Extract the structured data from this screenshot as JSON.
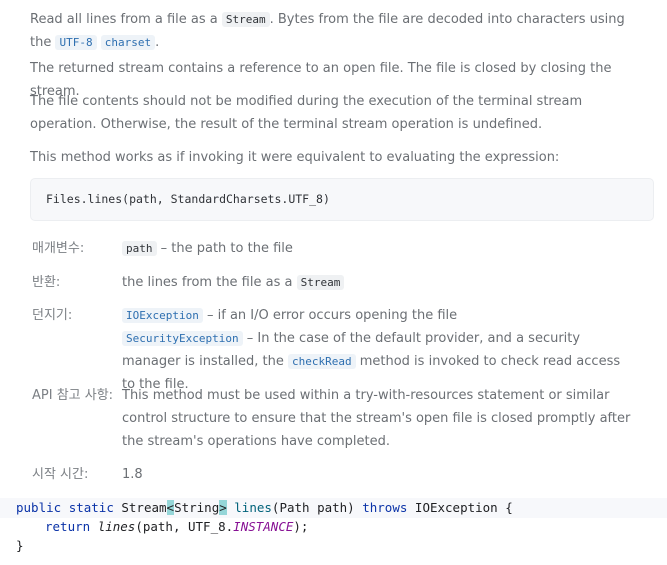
{
  "doc": {
    "p1": {
      "t1": "Read all lines from a file as a ",
      "c1": "Stream",
      "t2": ". Bytes from the file are decoded into characters using the ",
      "c2": "UTF-8",
      "t3": " ",
      "c3": "charset",
      "t4": "."
    },
    "p2": "The returned stream contains a reference to an open file. The file is closed by closing the stream.",
    "p3": "The file contents should not be modified during the execution of the terminal stream operation. Otherwise, the result of the terminal stream operation is undefined.",
    "p4": "This method works as if invoking it were equivalent to evaluating the expression:",
    "codeblock": "Files.lines(path, StandardCharsets.UTF_8)",
    "params": {
      "label": "매개변수:",
      "code": "path",
      "text": " – the path to the file"
    },
    "returns": {
      "label": "반환:",
      "text": "the lines from the file as a ",
      "code": "Stream"
    },
    "throws": {
      "label": "던지기:",
      "e1": "IOException",
      "e1_text": " – if an I/O error occurs opening the file",
      "e2": "SecurityException",
      "e2_text1": " – In the case of the default provider, and a security manager is installed, the ",
      "e2_code": "checkRead",
      "e2_text2": " method is invoked to check read access to the file."
    },
    "api_note": {
      "label": "API 참고 사항:",
      "text": "This method must be used within a try-with-resources statement or similar control structure to ensure that the stream's open file is closed promptly after the stream's operations have completed."
    },
    "since": {
      "label": "시작 시간:",
      "value": "1.8"
    }
  },
  "code": {
    "line1": {
      "kw1": "public",
      "kw2": "static",
      "type": "Stream",
      "lt": "<",
      "generic": "String",
      "gt": ">",
      "method": "lines",
      "params": "(Path path) ",
      "kw3": "throws",
      "exc": " IOException {"
    },
    "line2": {
      "kw": "return",
      "call": "lines",
      "args": "(path, UTF_8.",
      "const": "INSTANCE",
      "end": ");"
    },
    "line3": "}"
  },
  "colors": {
    "keyword": "#0b33a8",
    "method": "#00627a",
    "constant": "#871094",
    "bracket_highlight": "#95d6d8",
    "link_code": "#2e6fb0"
  }
}
